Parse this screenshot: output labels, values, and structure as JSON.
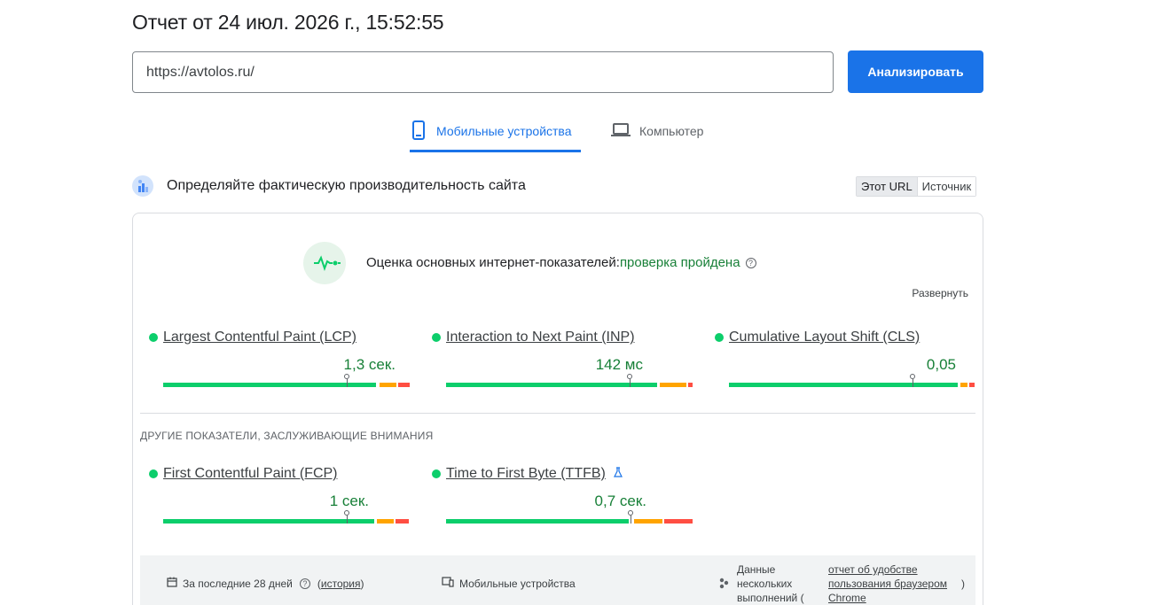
{
  "report": {
    "title": "Отчет от 24 июл. 2026 г., 15:52:55"
  },
  "search": {
    "url_value": "https://avtolos.ru/",
    "analyze_label": "Анализировать"
  },
  "tabs": [
    {
      "label": "Мобильные устройства",
      "icon": "mobile-icon",
      "active": true
    },
    {
      "label": "Компьютер",
      "icon": "laptop-icon",
      "active": false
    }
  ],
  "field_data": {
    "heading": "Определяйте фактическую производительность сайта",
    "toggle": {
      "this_url": "Этот URL",
      "origin": "Источник"
    }
  },
  "assessment": {
    "label": "Оценка основных интернет-показателей:",
    "status": "проверка пройдена",
    "expand_label": "Развернуть",
    "help_glyph": "?"
  },
  "core_metrics": [
    {
      "name": "Largest Contentful Paint (LCP)",
      "value": "1,3 сек.",
      "status_color": "#0cce6b"
    },
    {
      "name": "Interaction to Next Paint (INP)",
      "value": "142 мс",
      "status_color": "#0cce6b"
    },
    {
      "name": "Cumulative Layout Shift (CLS)",
      "value": "0,05",
      "status_color": "#0cce6b"
    }
  ],
  "other_title": "ДРУГИЕ ПОКАЗАТЕЛИ, ЗАСЛУЖИВАЮЩИЕ ВНИМАНИЯ",
  "other_metrics": [
    {
      "name": "First Contentful Paint (FCP)",
      "value": "1 сек.",
      "status_color": "#0cce6b"
    },
    {
      "name": "Time to First Byte (TTFB)",
      "value": "0,7 сек.",
      "status_color": "#0cce6b",
      "experimental": true
    }
  ],
  "distribution_colors": {
    "good": "#0cce6b",
    "needs_improvement": "#ffa400",
    "poor": "#ff4e42"
  },
  "footer": {
    "period": "За последние 28 дней",
    "history_open": "(",
    "history_link": "история",
    "history_close": ")",
    "device": "Мобильные устройства",
    "data_line1": "Данные",
    "data_line2": "нескольких",
    "data_line3": "выполнений (",
    "crux_line1": "отчет об удобстве",
    "crux_line2": "пользования браузером",
    "crux_line3": "Chrome",
    "crux_close": ")"
  }
}
